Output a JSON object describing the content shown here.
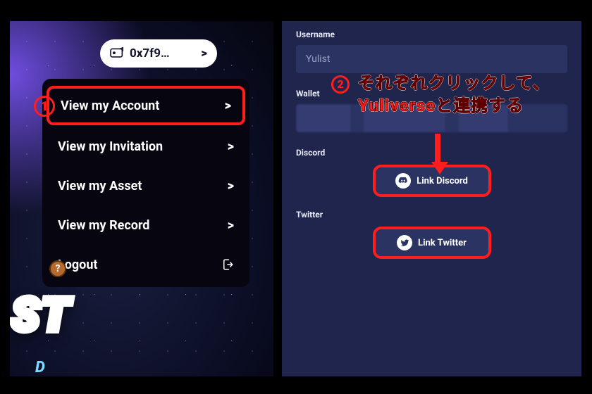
{
  "left": {
    "wallet_short": "0x7f9…",
    "wallet_chev": ">",
    "bg_title": "ST",
    "bg_sub": "D",
    "help_glyph": "?",
    "menu": {
      "items": [
        {
          "label": "View my Account",
          "chev": ">",
          "highlight": true
        },
        {
          "label": "View my Invitation",
          "chev": ">",
          "highlight": false
        },
        {
          "label": "View my Asset",
          "chev": ">",
          "highlight": false
        },
        {
          "label": "View my Record",
          "chev": ">",
          "highlight": false
        },
        {
          "label": "Logout",
          "chev": "",
          "highlight": false,
          "is_logout": true
        }
      ]
    }
  },
  "right": {
    "sections": [
      {
        "key": "username",
        "label": "Username",
        "value": "Yulist",
        "type": "text"
      },
      {
        "key": "wallet",
        "label": "Wallet",
        "value": "",
        "type": "blurred"
      },
      {
        "key": "discord",
        "label": "Discord",
        "button": "Link Discord",
        "icon": "discord-icon",
        "type": "link"
      },
      {
        "key": "twitter",
        "label": "Twitter",
        "button": "Link Twitter",
        "icon": "twitter-icon",
        "type": "link"
      }
    ]
  },
  "annot": {
    "marker1": "1",
    "marker2": "2",
    "line1": "それぞれクリックして、",
    "line2": "Yuliverseと連携する"
  },
  "colors": {
    "accent_red": "#ff1d1d",
    "panel_bg": "#1f254c",
    "field_bg": "#2b3363"
  }
}
